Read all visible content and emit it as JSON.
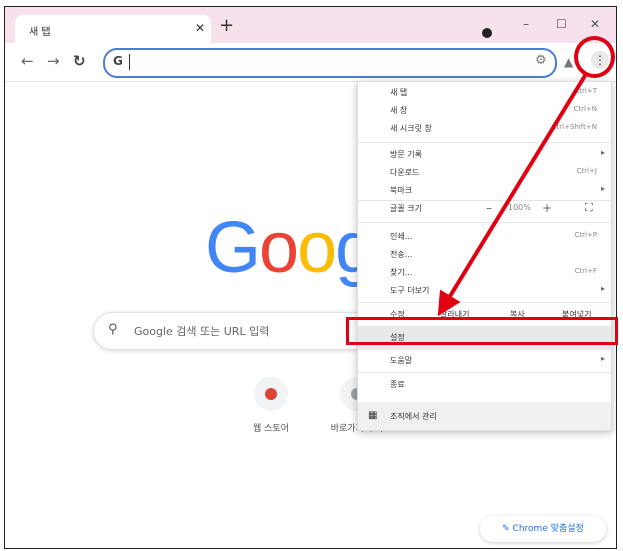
{
  "browser": {
    "tab_title": "새 탭",
    "tab_close": "✕",
    "new_tab": "+",
    "win_minimize": "–",
    "win_maximize": "☐",
    "win_close": "✕",
    "omnibox_prefix": "G"
  },
  "page": {
    "logo": [
      "G",
      "o",
      "o",
      "g"
    ],
    "logo_colors": [
      "#4285f4",
      "#ea4335",
      "#fbbc05",
      "#4285f4"
    ],
    "search_placeholder": "Google 검색 또는 URL 입력",
    "shortcuts": [
      {
        "label": "웹 스토어",
        "color": "#db4437"
      },
      {
        "label": "바로가기 추가",
        "color": "#9aa0a6"
      }
    ],
    "customize_label": "✎ Chrome 맞춤설정"
  },
  "menu": {
    "items": [
      {
        "label": "새 탭",
        "shortcut": "Ctrl+T"
      },
      {
        "label": "새 창",
        "shortcut": "Ctrl+N"
      },
      {
        "label": "새 시크릿 창",
        "shortcut": "Ctrl+Shift+N"
      },
      {
        "label": "방문 기록",
        "arrow": "▸"
      },
      {
        "label": "다운로드",
        "shortcut": "Ctrl+J"
      },
      {
        "label": "북마크",
        "arrow": "▸"
      }
    ],
    "zoom": {
      "label": "글꼴 크기",
      "minus": "–",
      "percent": "100%",
      "plus": "+",
      "fullscreen": "⛶"
    },
    "items2": [
      {
        "label": "인쇄...",
        "shortcut": "Ctrl+P"
      },
      {
        "label": "전송..."
      },
      {
        "label": "찾기...",
        "shortcut": "Ctrl+F"
      },
      {
        "label": "도구 더보기",
        "arrow": "▸"
      }
    ],
    "edit": {
      "label": "수정",
      "cut": "잘라내기",
      "copy": "복사",
      "paste": "붙여넣기"
    },
    "settings": "설정",
    "help": {
      "label": "도움말",
      "arrow": "▸"
    },
    "exit": "종료",
    "managed": "조직에서 관리"
  },
  "annotation_color": "#e00012"
}
